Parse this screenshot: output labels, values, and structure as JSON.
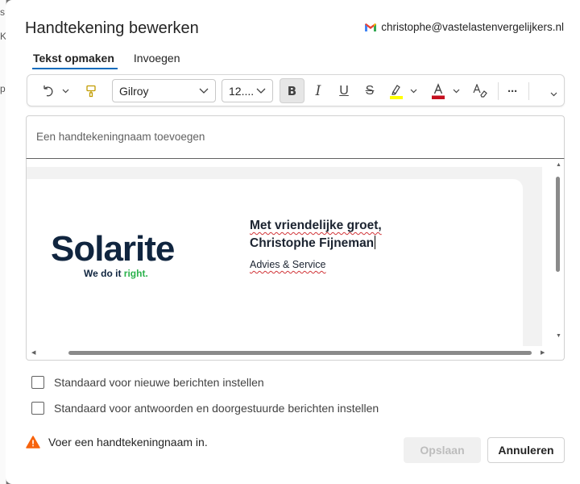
{
  "background": {
    "partial_letters": [
      "s",
      "K",
      "p"
    ]
  },
  "dialog": {
    "title": "Handtekening bewerken",
    "account_email": "christophe@vastelastenvergelijkers.nl"
  },
  "tabs": [
    {
      "label": "Tekst opmaken",
      "active": true
    },
    {
      "label": "Invoegen",
      "active": false
    }
  ],
  "toolbar": {
    "font_name": "Gilroy",
    "font_size": "12....",
    "bold_glyph": "B",
    "italic_glyph": "I",
    "underline_glyph": "U",
    "strike_glyph": "S",
    "more_glyph": "···",
    "highlight_color": "#ffff00",
    "font_color": "#c50f1f"
  },
  "name_field": {
    "placeholder": "Een handtekeningnaam toevoegen"
  },
  "signature": {
    "logo_name": "Solarite",
    "logo_tagline_prefix": "We do it ",
    "logo_tagline_accent": "right.",
    "greeting": "Met vriendelijke groet,",
    "name": "Christophe Fijneman",
    "role": "Advies & Service"
  },
  "options": {
    "default_new": "Standaard voor nieuwe berichten instellen",
    "default_replies": "Standaard voor antwoorden en doorgestuurde berichten instellen"
  },
  "warning": {
    "text": "Voer een handtekeningnaam in."
  },
  "buttons": {
    "save": "Opslaan",
    "cancel": "Annuleren"
  },
  "colors": {
    "accent": "#0f6cbd",
    "warning": "#f7630c",
    "logo_navy": "#10253f",
    "logo_green": "#2bb24c"
  }
}
